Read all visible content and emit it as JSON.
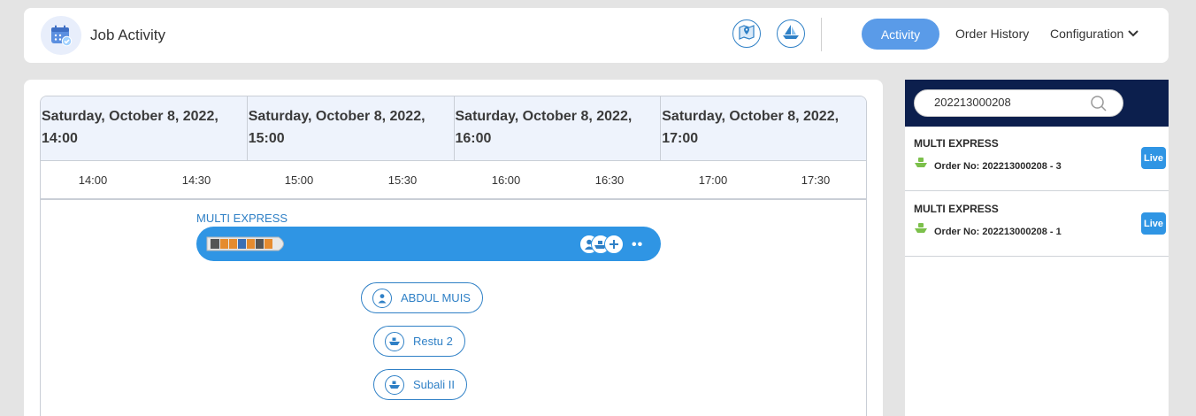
{
  "header": {
    "title": "Job Activity",
    "icons": {
      "app": "calendar-check-icon",
      "map": "map-pin-icon",
      "vessel": "sailboat-icon"
    },
    "nav": {
      "activity": "Activity",
      "order_history": "Order History",
      "configuration": "Configuration"
    }
  },
  "timeline": {
    "dates": [
      "Saturday, October 8, 2022, 14:00",
      "Saturday, October 8, 2022, 15:00",
      "Saturday, October 8, 2022, 16:00",
      "Saturday, October 8, 2022, 17:00"
    ],
    "ticks": [
      "14:00",
      "14:30",
      "15:00",
      "15:30",
      "16:00",
      "16:30",
      "17:00",
      "17:30"
    ],
    "job": {
      "title": "MULTI EXPRESS",
      "more_label": "••",
      "resources": [
        {
          "label": "ABDUL MUIS",
          "icon": "person-icon"
        },
        {
          "label": "Restu 2",
          "icon": "boat-icon"
        },
        {
          "label": "Subali II",
          "icon": "boat-icon"
        }
      ]
    }
  },
  "side": {
    "search": {
      "value": "202213000208"
    },
    "orders": [
      {
        "name": "MULTI EXPRESS",
        "order_no": "Order No: 202213000208 - 3",
        "badge": "Live"
      },
      {
        "name": "MULTI EXPRESS",
        "order_no": "Order No: 202213000208 - 1",
        "badge": "Live"
      }
    ]
  },
  "colors": {
    "accent": "#2f95e4",
    "nav_active": "#5a9be8",
    "search_bar": "#0c1f4d",
    "ship_icon": "#7cc04b"
  }
}
